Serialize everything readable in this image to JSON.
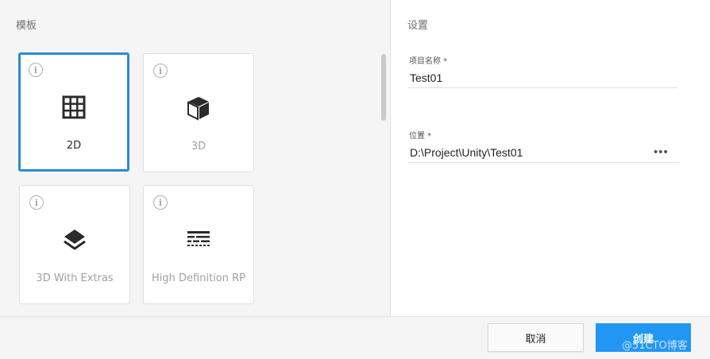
{
  "templates": {
    "title": "模板",
    "items": [
      {
        "label": "2D",
        "icon": "grid-icon",
        "selected": true
      },
      {
        "label": "3D",
        "icon": "cube-icon",
        "selected": false
      },
      {
        "label": "3D With Extras",
        "icon": "layers-icon",
        "selected": false
      },
      {
        "label": "High Definition RP",
        "icon": "hdrp-lines-icon",
        "selected": false
      }
    ],
    "info_glyph": "i"
  },
  "settings": {
    "title": "设置",
    "project_name": {
      "label": "项目名称 *",
      "value": "Test01"
    },
    "location": {
      "label": "位置 *",
      "value": "D:\\Project\\Unity\\Test01",
      "more": "•••"
    }
  },
  "footer": {
    "cancel_label": "取消",
    "create_label": "创建"
  },
  "watermark": "@51CTO博客",
  "colors": {
    "accent": "#2196f3",
    "selected_border": "#2a8ad8"
  }
}
